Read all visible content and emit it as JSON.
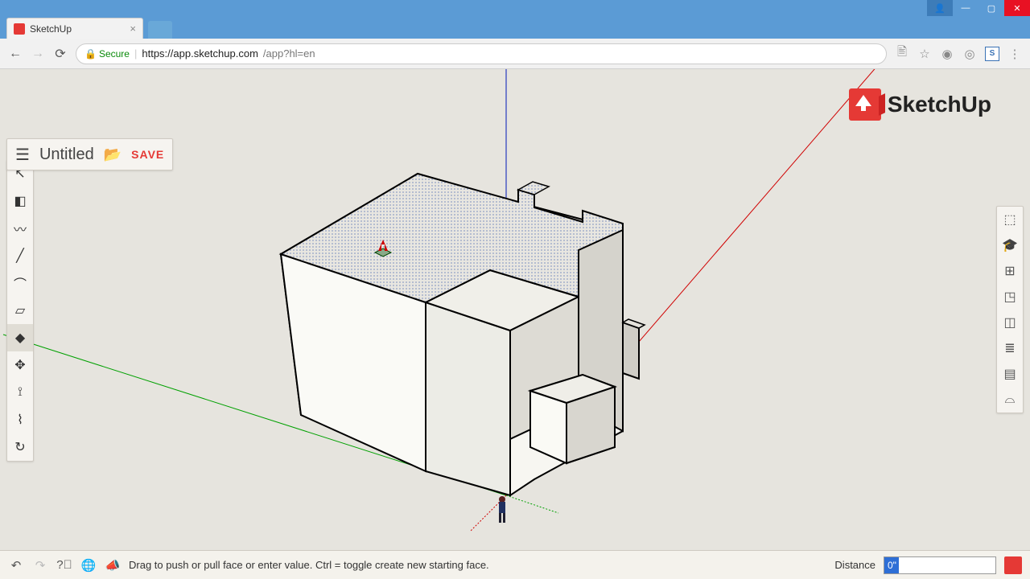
{
  "window": {
    "tab_title": "SketchUp",
    "url_secure_label": "Secure",
    "url_host": "https://app.sketchup.com",
    "url_path": "/app?hl=en"
  },
  "app": {
    "doc_title": "Untitled",
    "save_label": "SAVE",
    "logo_text": "SketchUp"
  },
  "left_tools": [
    {
      "name": "select",
      "glyph": "↖"
    },
    {
      "name": "eraser",
      "glyph": "◧"
    },
    {
      "name": "freehand",
      "glyph": "〰"
    },
    {
      "name": "line",
      "glyph": "╱"
    },
    {
      "name": "arc",
      "glyph": "⌒"
    },
    {
      "name": "rectangle",
      "glyph": "▱"
    },
    {
      "name": "pushpull",
      "glyph": "◆",
      "active": true
    },
    {
      "name": "move",
      "glyph": "✥"
    },
    {
      "name": "tape",
      "glyph": "⟟"
    },
    {
      "name": "paint",
      "glyph": "⌇"
    },
    {
      "name": "orbit",
      "glyph": "↻"
    }
  ],
  "right_panels": [
    {
      "name": "entity-info",
      "glyph": "⬚"
    },
    {
      "name": "instructor",
      "glyph": "🎓"
    },
    {
      "name": "components",
      "glyph": "⊞"
    },
    {
      "name": "materials",
      "glyph": "◳"
    },
    {
      "name": "styles",
      "glyph": "◫"
    },
    {
      "name": "layers",
      "glyph": "≣"
    },
    {
      "name": "scenes",
      "glyph": "▤"
    },
    {
      "name": "display",
      "glyph": "⌓"
    }
  ],
  "status": {
    "hint": "Drag to push or pull face or enter value. Ctrl = toggle create new starting face.",
    "vcb_label": "Distance",
    "vcb_value": "0\""
  }
}
